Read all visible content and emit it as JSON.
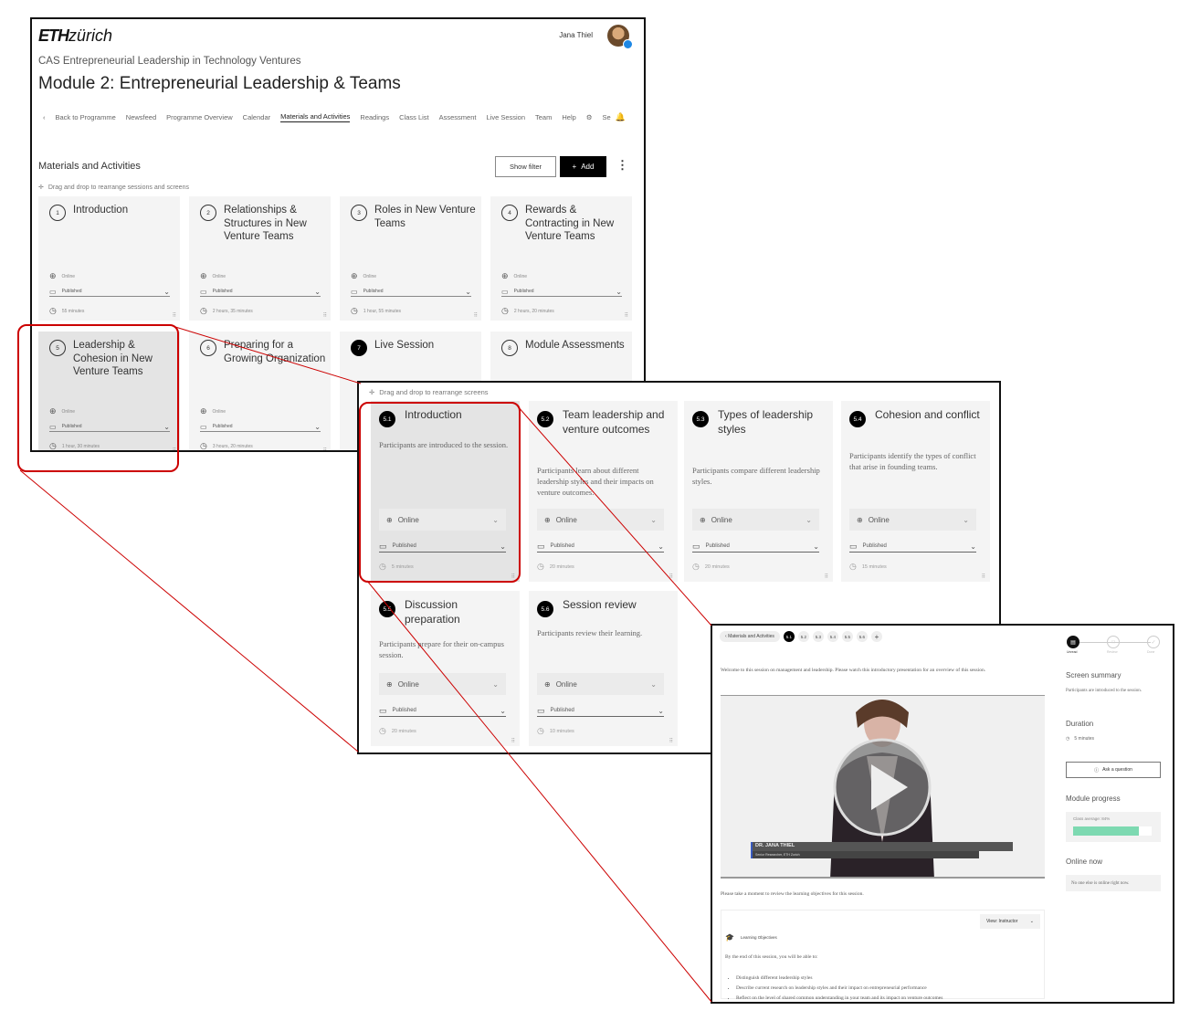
{
  "header": {
    "logo": {
      "bold": "ETH",
      "light": "zürich"
    },
    "user_name": "Jana Thiel",
    "programme": "CAS Entrepreneurial Leadership in Technology Ventures",
    "module_title": "Module 2: Entrepreneurial Leadership & Teams"
  },
  "nav": {
    "items": [
      "Back to Programme",
      "Newsfeed",
      "Programme Overview",
      "Calendar",
      "Materials and Activities",
      "Readings",
      "Class List",
      "Assessment",
      "Live Session",
      "Team",
      "Help",
      "Se"
    ],
    "active": "Materials and Activities"
  },
  "materials": {
    "title": "Materials and Activities",
    "show_filter": "Show filter",
    "add": "Add",
    "drag_hint": "Drag and drop to rearrange sessions and screens",
    "sessions": [
      {
        "num": "1",
        "title": "Introduction",
        "mode": "Online",
        "status": "Published",
        "duration": "55 minutes"
      },
      {
        "num": "2",
        "title": "Relationships & Structures in New Venture Teams",
        "mode": "Online",
        "status": "Published",
        "duration": "2 hours, 35 minutes"
      },
      {
        "num": "3",
        "title": "Roles in New Venture Teams",
        "mode": "Online",
        "status": "Published",
        "duration": "1 hour, 55 minutes"
      },
      {
        "num": "4",
        "title": "Rewards & Contracting in New Venture Teams",
        "mode": "Online",
        "status": "Published",
        "duration": "2 hours, 20 minutes"
      },
      {
        "num": "5",
        "title": "Leadership & Cohesion in New Venture Teams",
        "mode": "Online",
        "status": "Published",
        "duration": "1 hour, 30 minutes",
        "selected": true
      },
      {
        "num": "6",
        "title": "Preparing for a Growing Organization",
        "mode": "Online",
        "status": "Published",
        "duration": "3 hours, 20 minutes"
      },
      {
        "num": "7",
        "title": "Live Session",
        "dark": true
      },
      {
        "num": "8",
        "title": "Module Assessments"
      }
    ]
  },
  "screens": {
    "drag_hint": "Drag and drop to rearrange screens",
    "items": [
      {
        "num": "5.1",
        "title": "Introduction",
        "desc": "Participants are introduced to the session.",
        "mode": "Online",
        "status": "Published",
        "duration": "5 minutes",
        "selected": true
      },
      {
        "num": "5.2",
        "title": "Team leadership and venture outcomes",
        "desc": "Participants learn about different leadership styles and their impacts on venture outcomes.",
        "mode": "Online",
        "status": "Published",
        "duration": "20 minutes"
      },
      {
        "num": "5.3",
        "title": "Types of leadership styles",
        "desc": "Participants compare different leadership styles.",
        "mode": "Online",
        "status": "Published",
        "duration": "20 minutes"
      },
      {
        "num": "5.4",
        "title": "Cohesion and conflict",
        "desc": "Participants identify the types of conflict that arise in founding teams.",
        "mode": "Online",
        "status": "Published",
        "duration": "15 minutes"
      },
      {
        "num": "5.5",
        "title": "Discussion preparation",
        "desc": "Participants prepare for their on-campus session.",
        "mode": "Online",
        "status": "Published",
        "duration": "20 minutes"
      },
      {
        "num": "5.6",
        "title": "Session review",
        "desc": "Participants review their learning.",
        "mode": "Online",
        "status": "Published",
        "duration": "10 minutes"
      }
    ]
  },
  "screen_view": {
    "back": "Materials and Activities",
    "pills": [
      "5.1",
      "5.2",
      "5.3",
      "5.4",
      "5.5",
      "5.6"
    ],
    "active_pill": "5.1",
    "steps": [
      "Unread",
      "Review",
      "Done"
    ],
    "active_step": "Unread",
    "welcome": "Welcome to this session on management and leadership. Please watch this introductory presentation for an overview of this session.",
    "video": {
      "name": "DR. JANA THIEL",
      "role": "Senior Researcher, ETH Zurich"
    },
    "review_prompt": "Please take a moment to review the learning objectives for this session.",
    "view_select": "View: Instructor",
    "lo_title": "Learning Objectives",
    "lo_intro": "By the end of this session, you will be able to:",
    "objectives": [
      "Distinguish different leadership styles",
      "Describe current research on leadership styles and their impact on entrepreneurial performance",
      "Reflect on the level of shared common understanding in your team and its impact on venture outcomes"
    ],
    "summary_title": "Screen summary",
    "summary": "Participants are introduced to the session.",
    "duration_title": "Duration",
    "duration": "5 minutes",
    "ask": "Ask a question",
    "progress_title": "Module progress",
    "progress_label": "Class average: 84%",
    "progress_value": 84,
    "progress_color": "#7dd9b1",
    "online_title": "Online now",
    "online_text": "No one else is online right now."
  },
  "colors": {
    "highlight": "#cc0000",
    "accent": "#000000"
  }
}
